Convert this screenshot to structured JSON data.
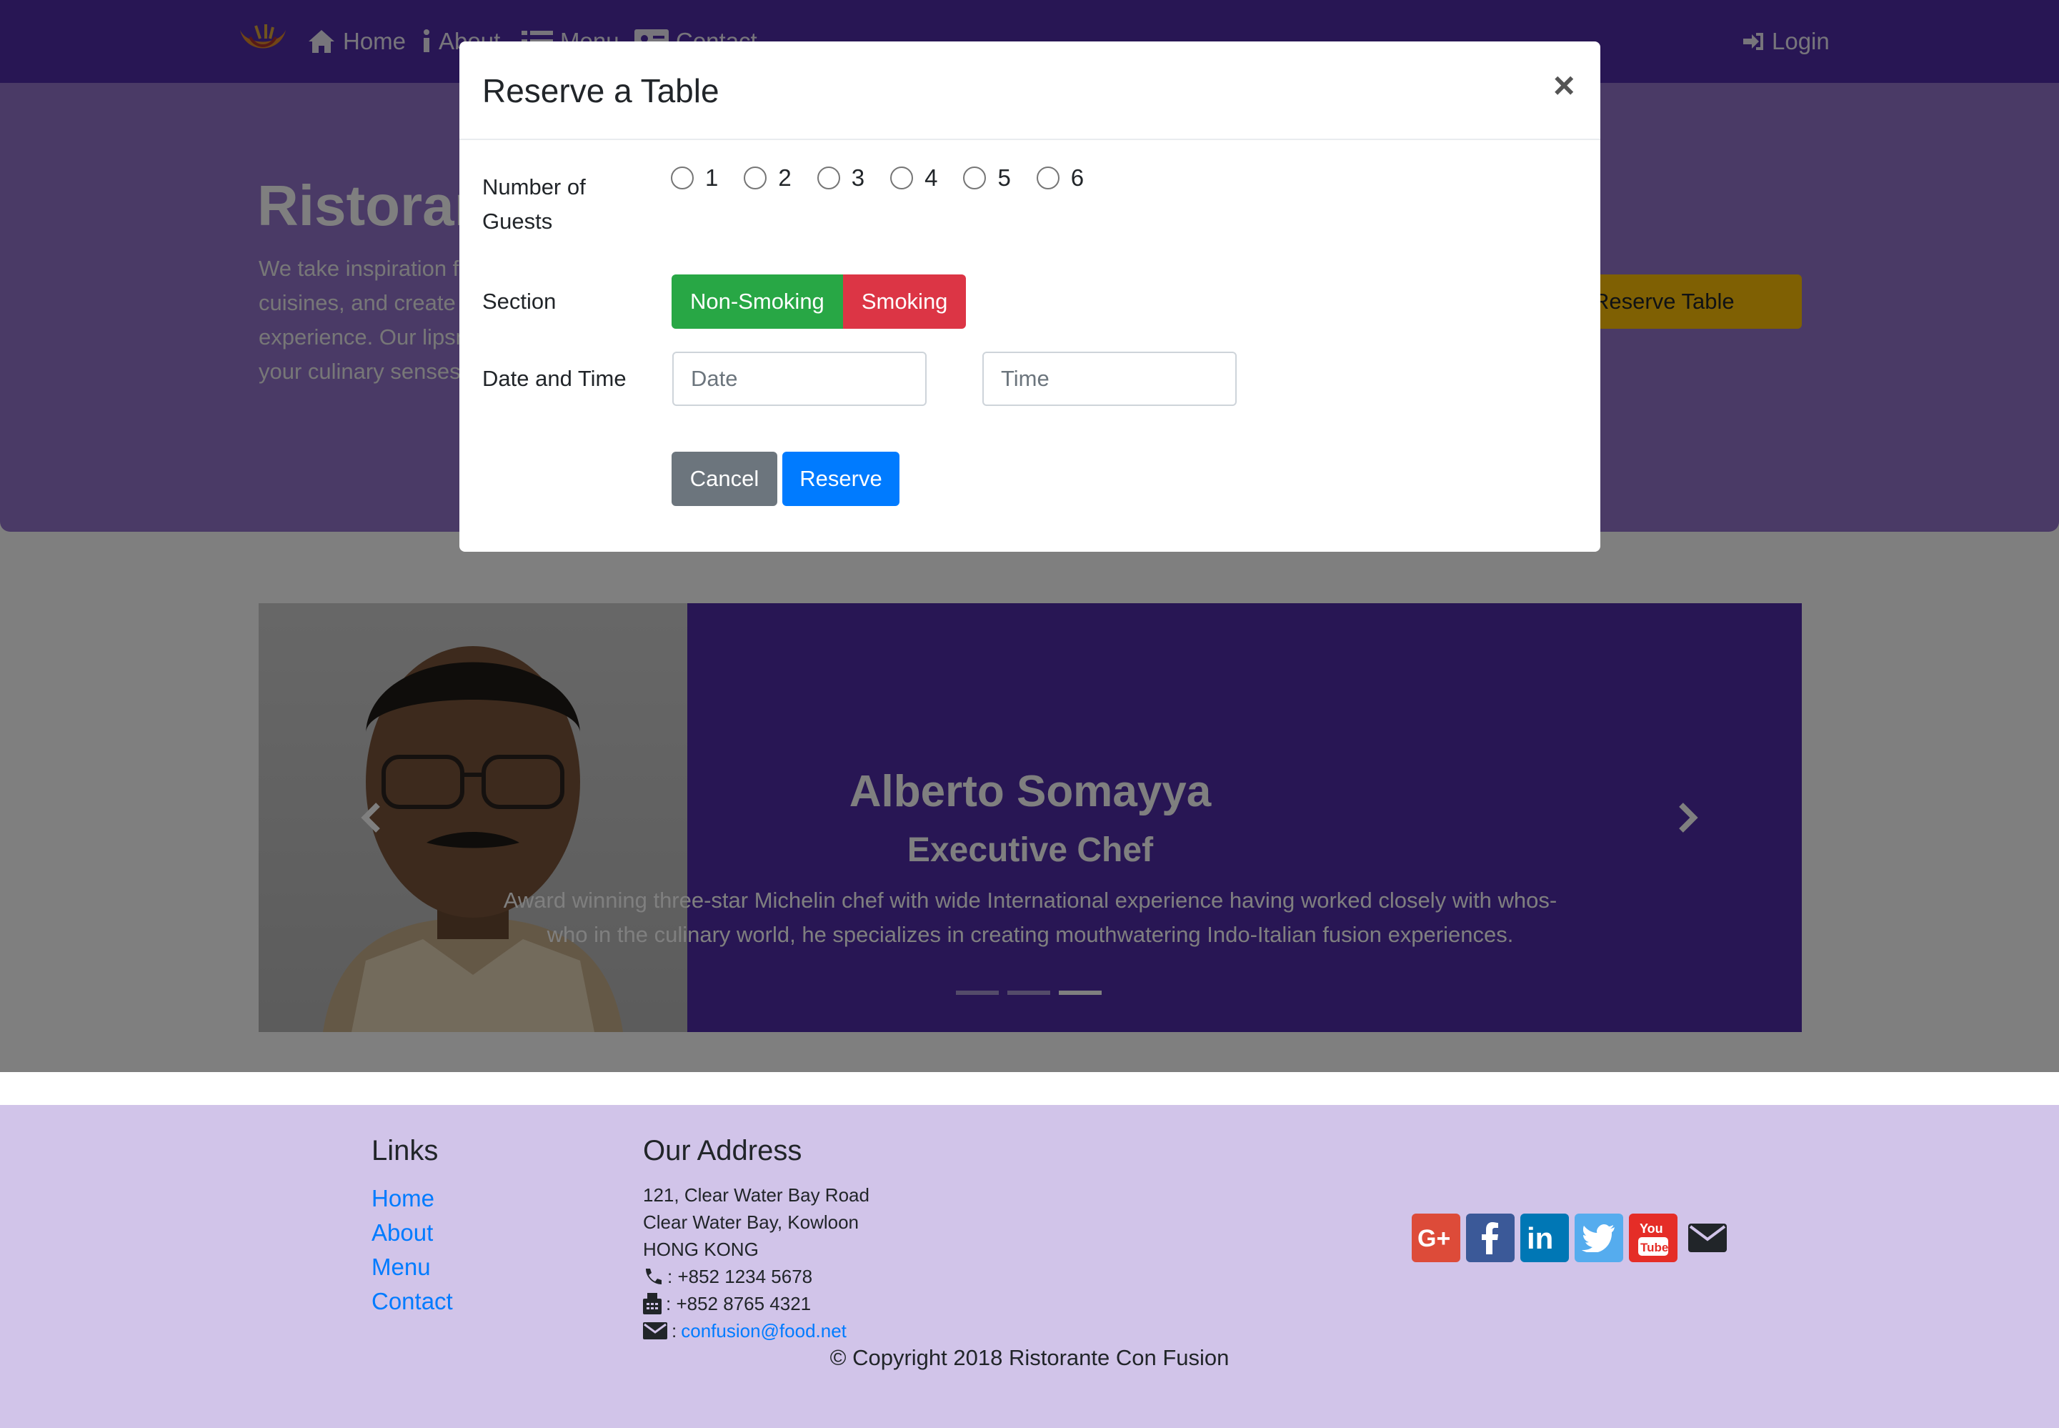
{
  "navbar": {
    "items": [
      {
        "label": "Home",
        "icon": "home-icon"
      },
      {
        "label": "About",
        "icon": "info-icon"
      },
      {
        "label": "Menu",
        "icon": "list-icon"
      },
      {
        "label": "Contact",
        "icon": "address-card-icon"
      }
    ],
    "login": {
      "label": "Login",
      "icon": "sign-in-icon"
    }
  },
  "jumbotron": {
    "title": "Ristorante Con Fusion",
    "text": "We take inspiration from the World's best cuisines, and create a unique fusion experience. Our lipsmacking creations will tickle your culinary senses!",
    "button": "Reserve Table"
  },
  "carousel": {
    "name": "Alberto Somayya",
    "role": "Executive Chef",
    "description": "Award winning three-star Michelin chef with wide International experience having worked closely with whos-who in the culinary world, he specializes in creating mouthwatering Indo-Italian fusion experiences.",
    "active_indicator": 3,
    "indicator_count": 3
  },
  "modal": {
    "title": "Reserve a Table",
    "close": "×",
    "guests_label": "Number of Guests",
    "guest_options": [
      "1",
      "2",
      "3",
      "4",
      "5",
      "6"
    ],
    "section_label": "Section",
    "section_options": [
      "Non-Smoking",
      "Smoking"
    ],
    "datetime_label": "Date and Time",
    "date_placeholder": "Date",
    "time_placeholder": "Time",
    "cancel": "Cancel",
    "reserve": "Reserve"
  },
  "footer": {
    "links_title": "Links",
    "links": [
      "Home",
      "About",
      "Menu",
      "Contact"
    ],
    "address_title": "Our Address",
    "address_lines": [
      "121, Clear Water Bay Road",
      "Clear Water Bay, Kowloon",
      "HONG KONG"
    ],
    "phone": ": +852 1234 5678",
    "fax": ": +852 8765 4321",
    "email_prefix": ":",
    "email": "confusion@food.net",
    "social": [
      "google-plus-icon",
      "facebook-icon",
      "linkedin-icon",
      "twitter-icon",
      "youtube-icon",
      "envelope-icon"
    ],
    "copyright": "© Copyright 2018 Ristorante Con Fusion"
  },
  "colors": {
    "primary_dark": "#512da8",
    "primary_light": "#9575cd",
    "footer_bg": "#d1c4e9",
    "warning": "#ffc107",
    "success": "#28a745",
    "danger": "#dc3545",
    "secondary": "#6c757d",
    "blue": "#007bff"
  }
}
